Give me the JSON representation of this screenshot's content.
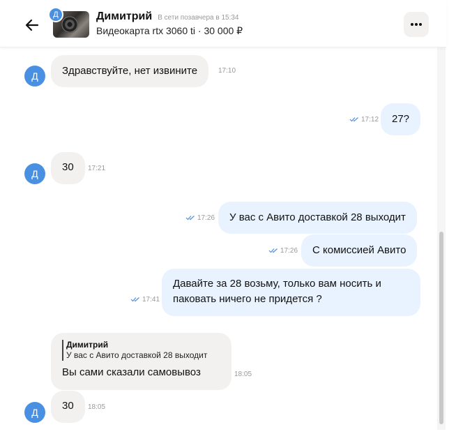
{
  "header": {
    "contact_name": "Димитрий",
    "status": "В сети позавчера в 15:34",
    "item": "Видеокарта rtx 3060 ti · 30 000 ₽",
    "avatar_letter": "Д",
    "back_icon": "arrow-left-icon",
    "more_icon": "more-horizontal-icon"
  },
  "messages": [
    {
      "dir": "in",
      "text": "Здравствуйте, нет извините",
      "time": "17:10",
      "avatar": "Д"
    },
    {
      "dir": "out",
      "text": "27?",
      "time": "17:12",
      "read": true
    },
    {
      "dir": "in",
      "text": "30",
      "time": "17:21",
      "avatar": "Д"
    },
    {
      "dir": "out",
      "text": "У вас с Авито доставкой 28 выходит",
      "time": "17:26",
      "read": true
    },
    {
      "dir": "out",
      "text": "С комиссией Авито",
      "time": "17:26",
      "read": true
    },
    {
      "dir": "out",
      "text_line1": "Давайте за 28 возьму, только вам носить и",
      "text_line2": "паковать ничего не придется ?",
      "time": "17:41",
      "read": true
    },
    {
      "dir": "in",
      "reply_name": "Димитрий",
      "reply_text": "У вас с Авито доставкой 28 выходит",
      "text": "Вы сами сказали самовывоз",
      "time": "18:05"
    },
    {
      "dir": "in",
      "text": "30",
      "time": "18:05",
      "avatar": "Д"
    }
  ],
  "colors": {
    "incoming_bubble": "#f2f1f0",
    "outgoing_bubble": "#e8f3ff",
    "avatar": "#4a90e2",
    "read_check": "#4a90e2"
  }
}
